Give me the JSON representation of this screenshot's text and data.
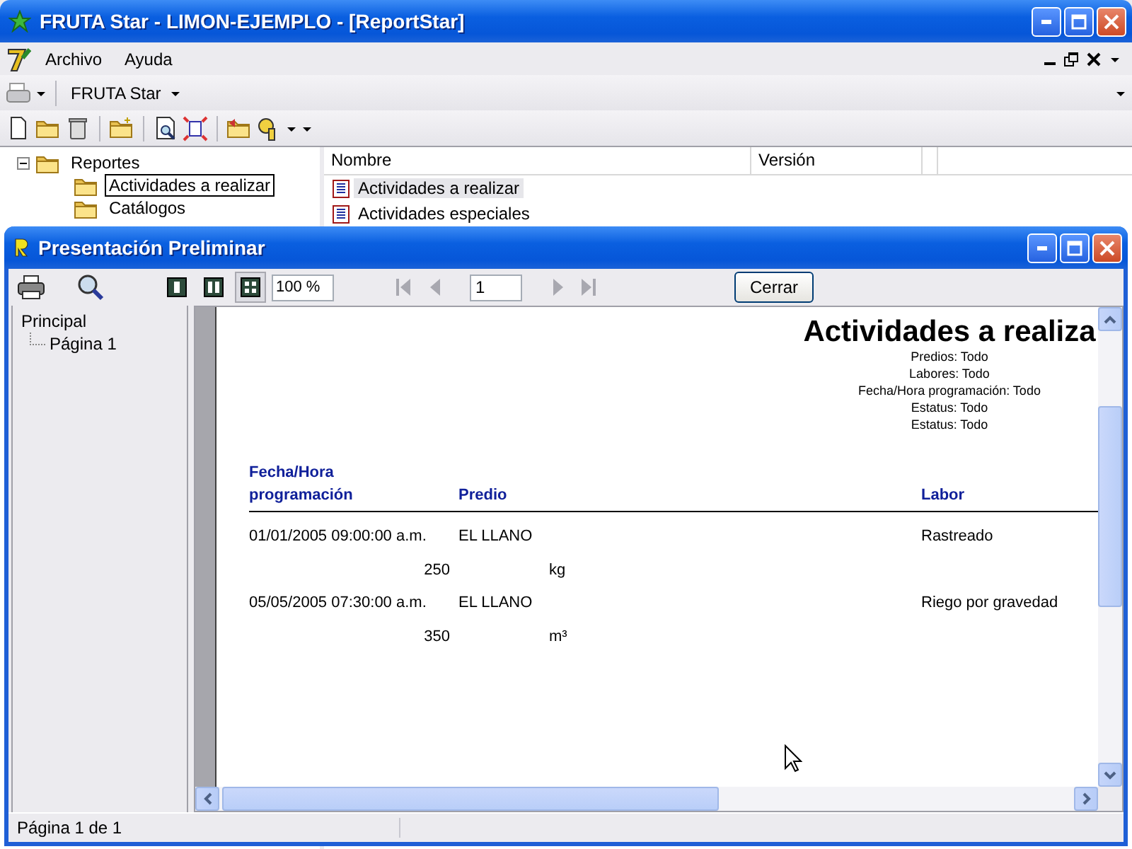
{
  "window": {
    "title": "FRUTA Star - LIMON-EJEMPLO - [ReportStar]"
  },
  "menu": [
    {
      "label": "Archivo"
    },
    {
      "label": "Ayuda"
    }
  ],
  "toolbar": {
    "combo": "FRUTA Star"
  },
  "tree": [
    {
      "label": "Reportes",
      "expanded": true,
      "selected": false,
      "children": [
        {
          "label": "Actividades a realizar",
          "selected": true
        },
        {
          "label": "Catálogos",
          "selected": false
        }
      ]
    }
  ],
  "list": {
    "columns": [
      "Nombre",
      "Versión"
    ],
    "rows": [
      {
        "name": "Actividades a realizar",
        "selected": true
      },
      {
        "name": "Actividades especiales",
        "selected": false
      }
    ]
  },
  "preview": {
    "title": "Presentación Preliminar",
    "view_modes": [
      {
        "kind": "single",
        "selected": false
      },
      {
        "kind": "double",
        "selected": false
      },
      {
        "kind": "multi",
        "selected": true
      }
    ],
    "zoom": "100 %",
    "page": "1",
    "nav": [
      {
        "kind": "first",
        "disabled": true
      },
      {
        "kind": "prev",
        "disabled": true
      },
      {
        "kind": "next",
        "disabled": true
      },
      {
        "kind": "last",
        "disabled": true
      }
    ],
    "close_button": "Cerrar",
    "outline": [
      {
        "label": "Principal",
        "children": [
          {
            "label": "Página 1"
          }
        ]
      }
    ],
    "report": {
      "title": "Actividades a realiza",
      "filters": [
        "Predios: Todo",
        "Labores: Todo",
        "Fecha/Hora programación: Todo",
        "Estatus: Todo",
        "Estatus: Todo"
      ],
      "columns": [
        "Fecha/Hora programación",
        "Predio",
        "Labor"
      ],
      "rows": [
        {
          "date": "01/01/2005 09:00:00 a.m.",
          "predio": "EL LLANO",
          "labor": "Rastreado",
          "quantity": "250",
          "unit": "kg"
        },
        {
          "date": "05/05/2005 07:30:00 a.m.",
          "predio": "EL LLANO",
          "labor": "Riego por gravedad",
          "quantity": "350",
          "unit": "m³"
        }
      ]
    },
    "status": "Página 1 de 1"
  }
}
